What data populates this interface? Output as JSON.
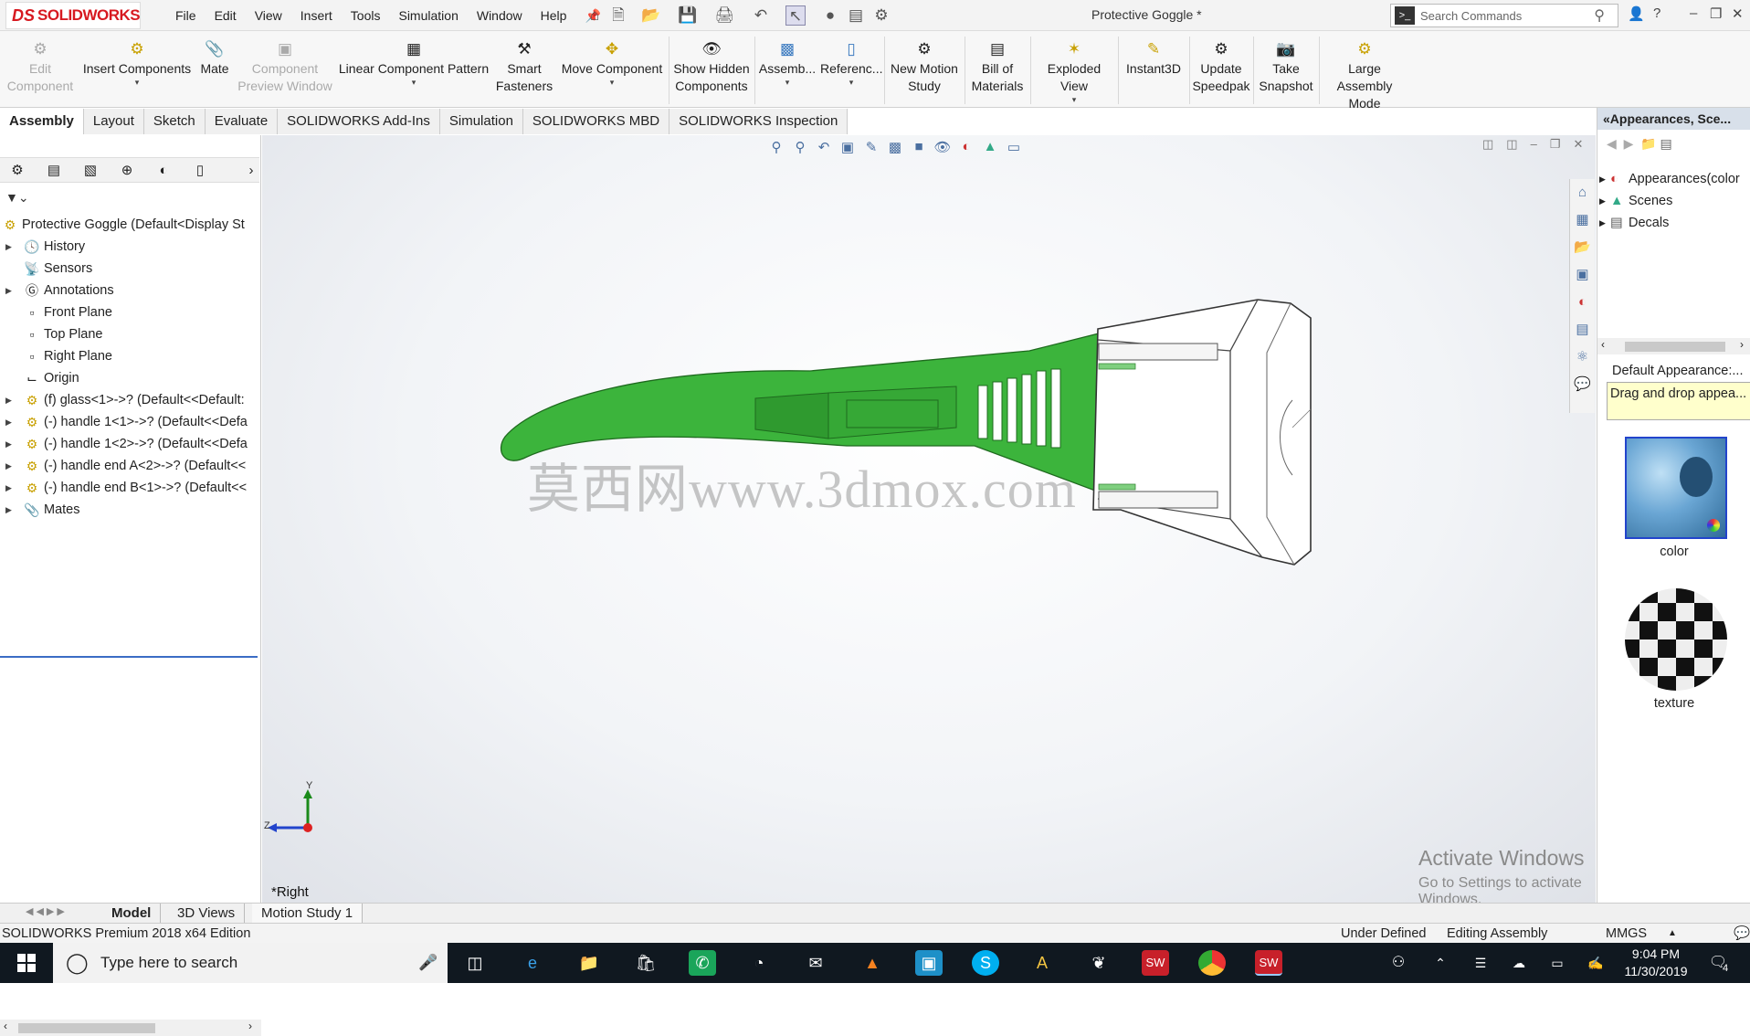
{
  "app": {
    "logo_text": "SOLIDWORKS",
    "doc_title": "Protective Goggle *"
  },
  "menu": [
    "File",
    "Edit",
    "View",
    "Insert",
    "Tools",
    "Simulation",
    "Window",
    "Help"
  ],
  "search": {
    "placeholder": "Search Commands"
  },
  "ribbon": [
    {
      "label": "Edit Component",
      "icon": "edit-component-icon",
      "enabled": false
    },
    {
      "label": "Insert Components",
      "icon": "insert-components-icon",
      "enabled": true
    },
    {
      "label": "Mate",
      "icon": "mate-icon",
      "enabled": true
    },
    {
      "label": "Component Preview Window",
      "icon": "component-preview-icon",
      "enabled": false
    },
    {
      "label": "Linear Component Pattern",
      "icon": "linear-pattern-icon",
      "enabled": true
    },
    {
      "label": "Smart Fasteners",
      "icon": "smart-fasteners-icon",
      "enabled": true
    },
    {
      "label": "Move Component",
      "icon": "move-component-icon",
      "enabled": true
    },
    {
      "label": "Show Hidden Components",
      "icon": "show-hidden-icon",
      "enabled": true
    },
    {
      "label": "Assemb...",
      "icon": "assembly-features-icon",
      "enabled": true
    },
    {
      "label": "Referenc...",
      "icon": "reference-geometry-icon",
      "enabled": true
    },
    {
      "label": "New Motion Study",
      "icon": "motion-study-icon",
      "enabled": true
    },
    {
      "label": "Bill of Materials",
      "icon": "bom-icon",
      "enabled": true
    },
    {
      "label": "Exploded View",
      "icon": "exploded-view-icon",
      "enabled": true
    },
    {
      "label": "Instant3D",
      "icon": "instant3d-icon",
      "enabled": true
    },
    {
      "label": "Update Speedpak",
      "icon": "speedpak-icon",
      "enabled": true
    },
    {
      "label": "Take Snapshot",
      "icon": "snapshot-icon",
      "enabled": true
    },
    {
      "label": "Large Assembly Mode",
      "icon": "large-assembly-icon",
      "enabled": true
    }
  ],
  "tabs": [
    "Assembly",
    "Layout",
    "Sketch",
    "Evaluate",
    "SOLIDWORKS Add-Ins",
    "Simulation",
    "SOLIDWORKS MBD",
    "SOLIDWORKS Inspection"
  ],
  "active_tab": "Assembly",
  "tree": {
    "root": "Protective Goggle  (Default<Display St",
    "items": [
      {
        "label": "History",
        "icon": "history-icon",
        "expandable": true
      },
      {
        "label": "Sensors",
        "icon": "sensors-icon",
        "expandable": false
      },
      {
        "label": "Annotations",
        "icon": "annotations-icon",
        "expandable": true
      },
      {
        "label": "Front Plane",
        "icon": "plane-icon",
        "expandable": false
      },
      {
        "label": "Top Plane",
        "icon": "plane-icon",
        "expandable": false
      },
      {
        "label": "Right Plane",
        "icon": "plane-icon",
        "expandable": false
      },
      {
        "label": "Origin",
        "icon": "origin-icon",
        "expandable": false
      },
      {
        "label": "(f) glass<1>->? (Default<<Default:",
        "icon": "part-icon",
        "expandable": true
      },
      {
        "label": "(-) handle 1<1>->? (Default<<Defa",
        "icon": "part-icon",
        "expandable": true
      },
      {
        "label": "(-) handle 1<2>->? (Default<<Defa",
        "icon": "part-icon",
        "expandable": true
      },
      {
        "label": "(-) handle end A<2>->? (Default<<",
        "icon": "part-icon",
        "expandable": true
      },
      {
        "label": "(-) handle end B<1>->? (Default<<",
        "icon": "part-icon",
        "expandable": true
      },
      {
        "label": "Mates",
        "icon": "mates-icon",
        "expandable": true
      }
    ]
  },
  "viewport": {
    "view_name": "*Right",
    "watermark": "莫西网www.3dmox.com",
    "axis": {
      "y": "Y",
      "z": "Z"
    },
    "activate_title": "Activate Windows",
    "activate_sub": "Go to Settings to activate Windows."
  },
  "right_panel": {
    "header": "Appearances, Sce...",
    "items": [
      {
        "label": "Appearances(color",
        "icon": "appearances-icon"
      },
      {
        "label": "Scenes",
        "icon": "scenes-icon"
      },
      {
        "label": "Decals",
        "icon": "decals-icon"
      }
    ],
    "default_appearance": "Default Appearance:...",
    "tip": "Drag and drop appea...",
    "swatches": [
      {
        "label": "color"
      },
      {
        "label": "texture"
      }
    ]
  },
  "bottom_tabs": [
    "Model",
    "3D Views",
    "Motion Study 1"
  ],
  "active_bottom_tab": "Model",
  "status": {
    "edition": "SOLIDWORKS Premium 2018 x64 Edition",
    "state": "Under Defined",
    "mode": "Editing Assembly",
    "units": "MMGS"
  },
  "taskbar": {
    "search_placeholder": "Type here to search",
    "time": "9:04 PM",
    "date": "11/30/2019",
    "notifications": "4"
  },
  "colors": {
    "brand": "#d71920",
    "part_green": "#3cb43c",
    "selection_blue": "#3b6cc5",
    "taskbar": "#101820"
  }
}
